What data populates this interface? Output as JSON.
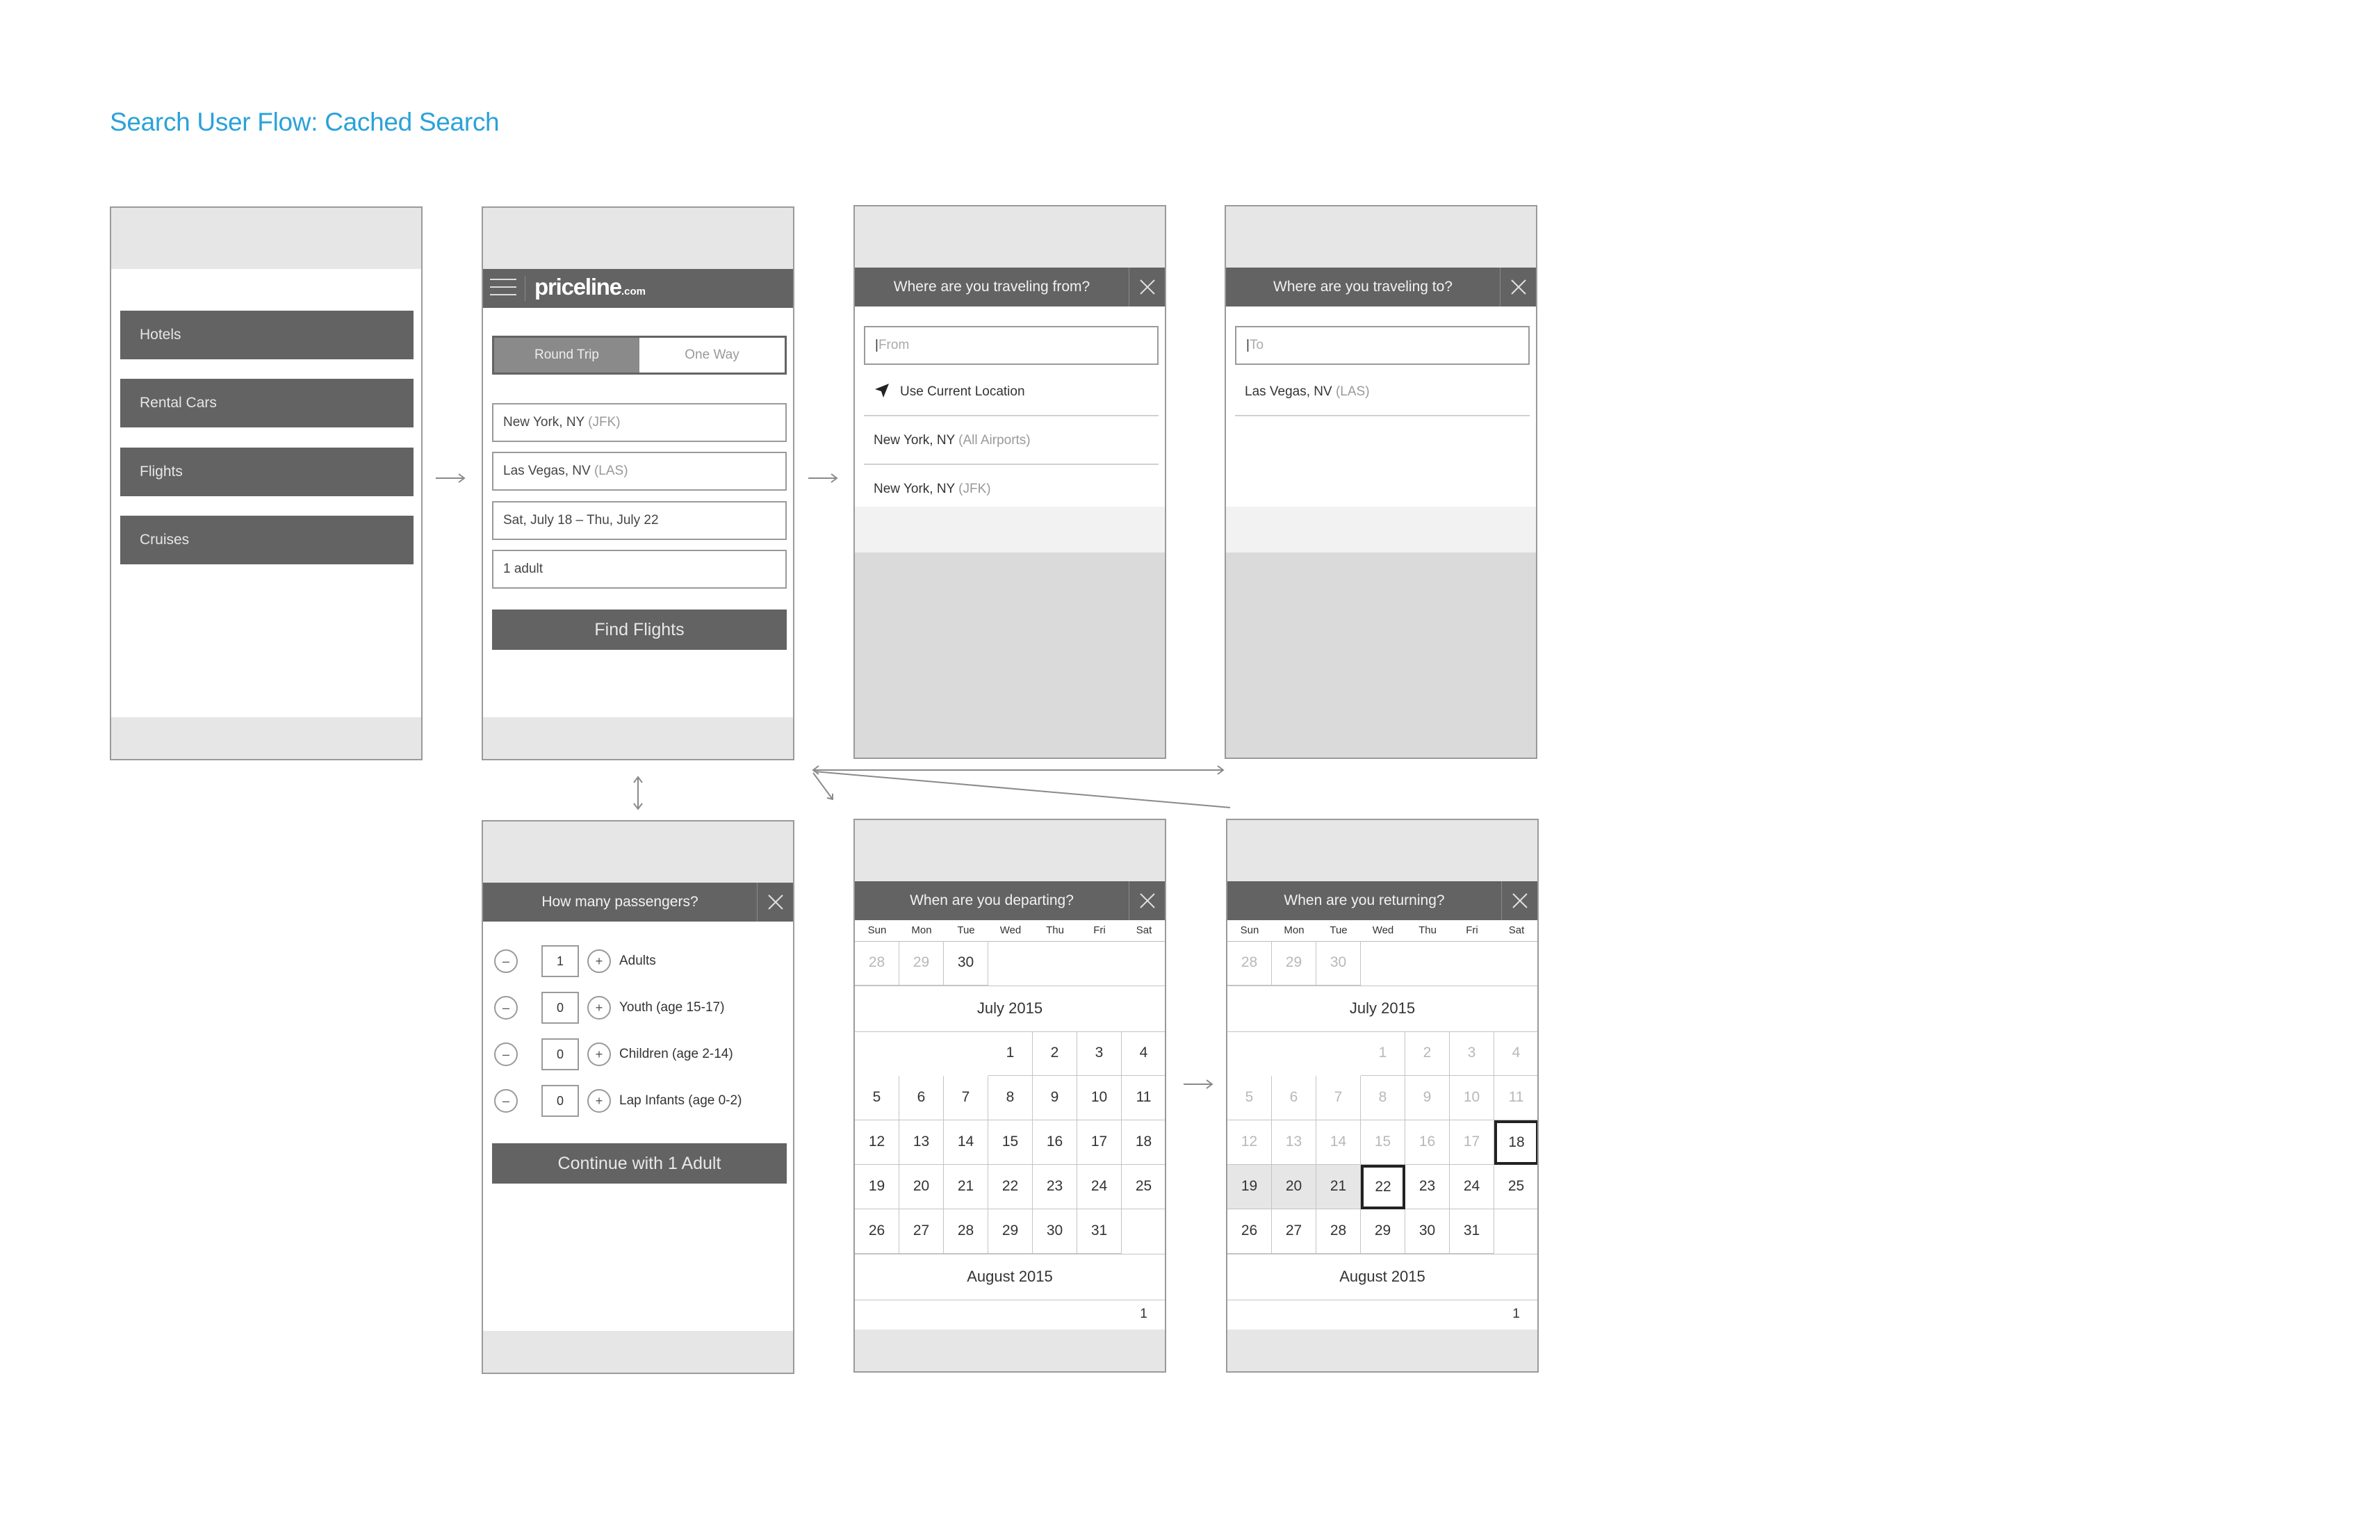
{
  "title": "Search User Flow: Cached Search",
  "screen_home": {
    "menu": [
      "Hotels",
      "Rental Cars",
      "Flights",
      "Cruises"
    ]
  },
  "screen_search": {
    "logo": "priceline",
    "logo_suffix": ".com",
    "trip_round": "Round Trip",
    "trip_oneway": "One Way",
    "origin_city": "New York, NY",
    "origin_code": "(JFK)",
    "dest_city": "Las Vegas, NV",
    "dest_code": "(LAS)",
    "dates": "Sat, July 18 – Thu, July 22",
    "passengers": "1 adult",
    "find_button": "Find Flights"
  },
  "screen_from": {
    "header": "Where are you traveling from?",
    "placeholder": "From",
    "current_location": "Use Current Location",
    "suggestions": [
      {
        "city": "New York, NY",
        "code": "(All Airports)"
      },
      {
        "city": "New York, NY",
        "code": "(JFK)"
      }
    ]
  },
  "screen_to": {
    "header": "Where are you traveling to?",
    "placeholder": "To",
    "suggestions": [
      {
        "city": "Las Vegas, NV",
        "code": "(LAS)"
      }
    ]
  },
  "screen_passengers": {
    "header": "How many passengers?",
    "rows": [
      {
        "value": "1",
        "label": "Adults"
      },
      {
        "value": "0",
        "label": "Youth (age 15-17)"
      },
      {
        "value": "0",
        "label": "Children (age 2-14)"
      },
      {
        "value": "0",
        "label": "Lap Infants (age 0-2)"
      }
    ],
    "minus": "–",
    "plus": "+",
    "continue_button": "Continue with 1 Adult"
  },
  "calendar": {
    "weekdays": [
      "Sun",
      "Mon",
      "Tue",
      "Wed",
      "Thu",
      "Fri",
      "Sat"
    ],
    "prev_days": [
      "28",
      "29",
      "30"
    ],
    "month1": "July 2015",
    "month2": "August 2015",
    "aug_first": "1"
  },
  "screen_depart": {
    "header": "When are you departing?"
  },
  "screen_return": {
    "header": "When are you returning?",
    "depart_day": "18",
    "return_day": "22"
  }
}
